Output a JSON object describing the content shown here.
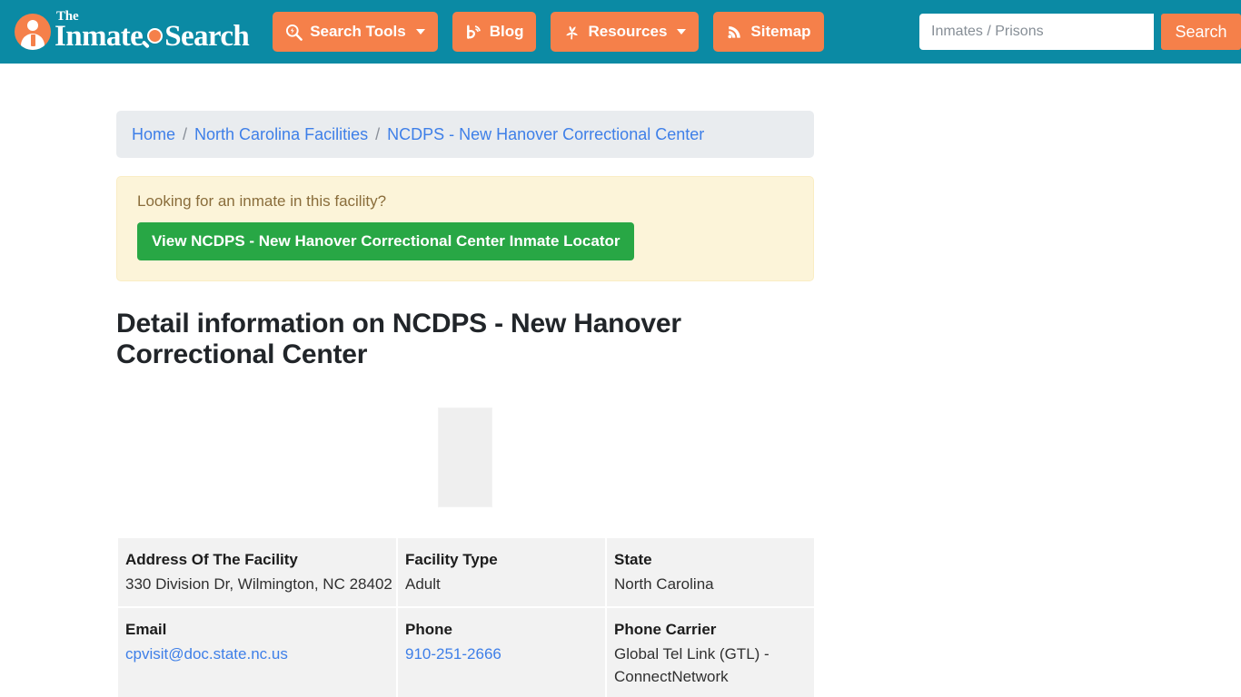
{
  "header": {
    "background_color": "#0b8aa4",
    "accent_color": "#f5804a",
    "logo": {
      "the": "The",
      "word1": "Inmate",
      "word2": "Search",
      "icon": "person-badge-icon",
      "glass_icon": "magnifier-icon"
    },
    "nav": [
      {
        "label": "Search Tools",
        "icon": "magnifier-bolt-icon",
        "has_caret": true
      },
      {
        "label": "Blog",
        "icon": "blogger-icon",
        "has_caret": false
      },
      {
        "label": "Resources",
        "icon": "clover-leaf-icon",
        "has_caret": true
      },
      {
        "label": "Sitemap",
        "icon": "rss-sitemap-icon",
        "has_caret": false
      }
    ],
    "search": {
      "placeholder": "Inmates / Prisons",
      "value": "",
      "button_label": "Search"
    }
  },
  "breadcrumb": {
    "items": [
      {
        "label": "Home",
        "current": false
      },
      {
        "label": "North Carolina Facilities",
        "current": false
      },
      {
        "label": "NCDPS - New Hanover Correctional Center",
        "current": true
      }
    ],
    "separator": "/"
  },
  "alert": {
    "text": "Looking for an inmate in this facility?",
    "button_label": "View NCDPS - New Hanover Correctional Center Inmate Locator",
    "button_color": "#28a745",
    "background_color": "#fcf4d9"
  },
  "page_title": "Detail information on NCDPS - New Hanover Correctional Center",
  "facility_image": {
    "state": "broken-image-placeholder",
    "alt": ""
  },
  "details": {
    "rows": [
      [
        {
          "label": "Address Of The Facility",
          "value": "330 Division Dr, Wilmington, NC 28402",
          "link": false
        },
        {
          "label": "Facility Type",
          "value": "Adult",
          "link": false
        },
        {
          "label": "State",
          "value": "North Carolina",
          "link": false
        }
      ],
      [
        {
          "label": "Email",
          "value": "cpvisit@doc.state.nc.us",
          "link": true
        },
        {
          "label": "Phone",
          "value": "910-251-2666",
          "link": true
        },
        {
          "label": "Phone Carrier",
          "value": "Global Tel Link (GTL) - ConnectNetwork",
          "link": false
        }
      ]
    ]
  }
}
